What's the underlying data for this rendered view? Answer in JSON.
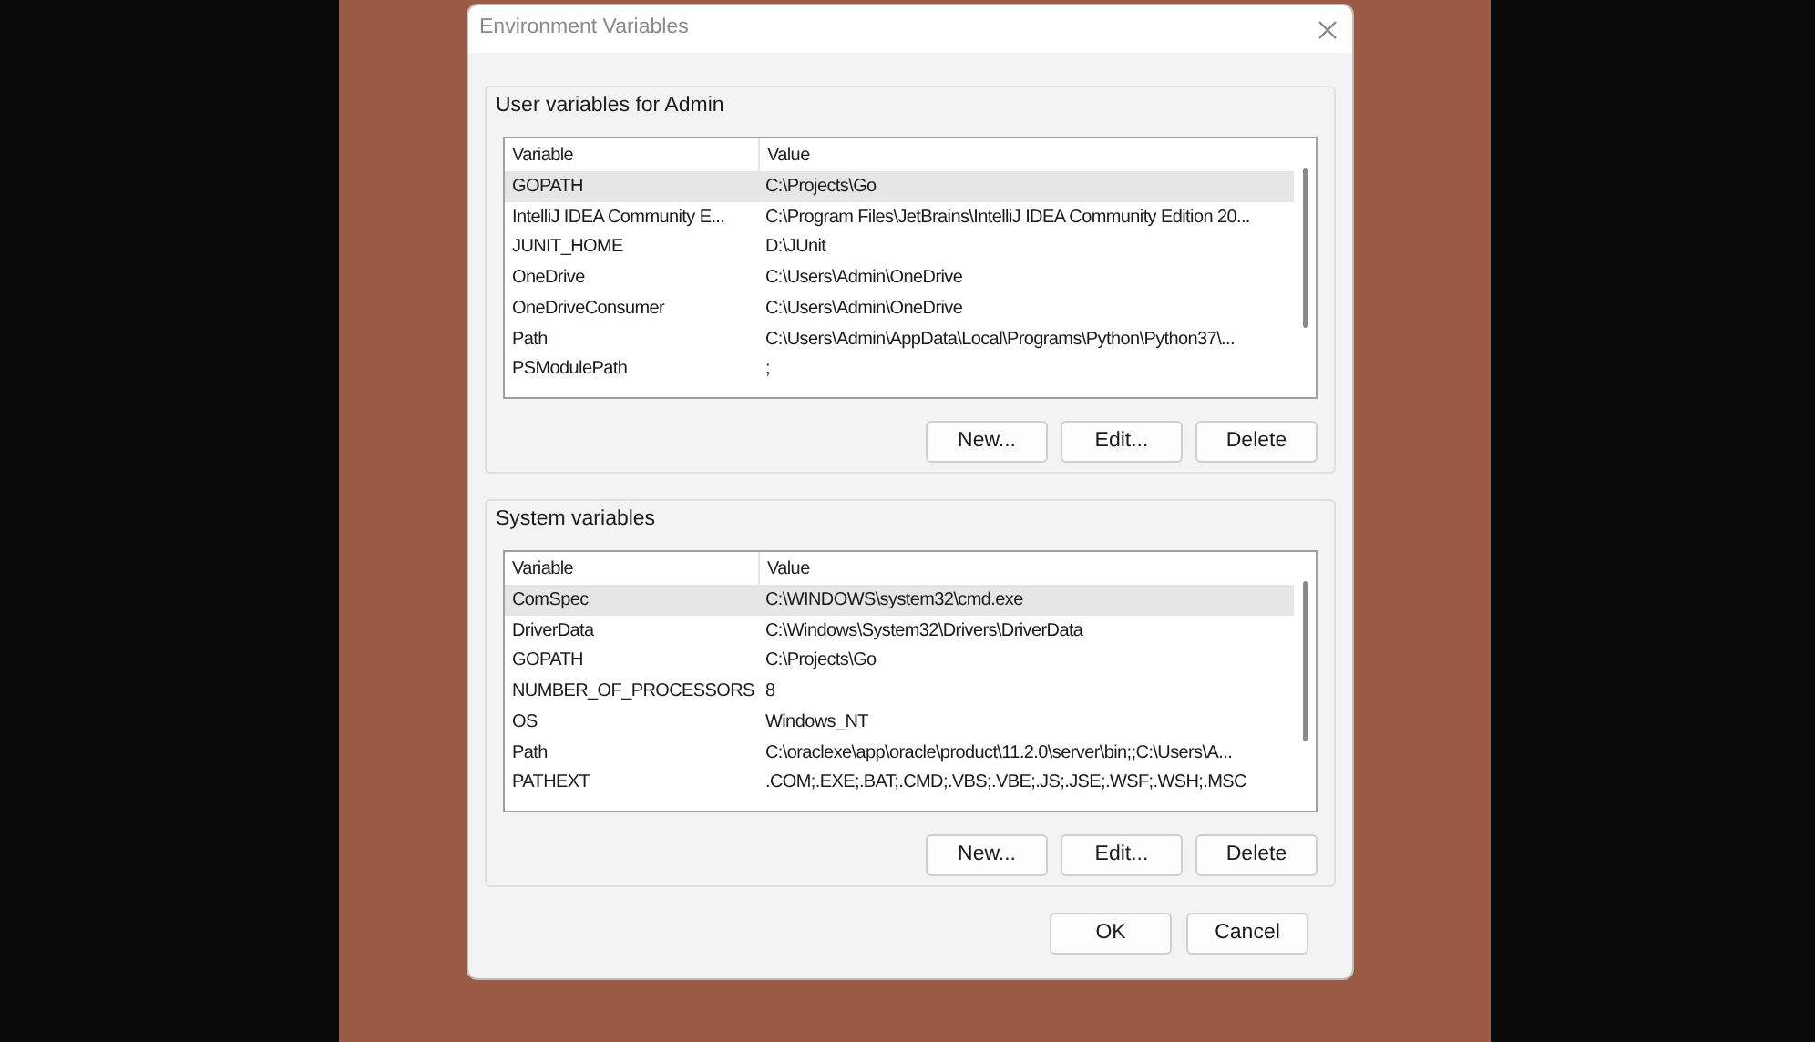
{
  "window": {
    "title": "Environment Variables"
  },
  "groups": [
    {
      "title": "User variables for Admin",
      "columns": [
        "Variable",
        "Value"
      ],
      "rows": [
        {
          "cells": [
            "GOPATH",
            "C:\\Projects\\Go"
          ],
          "selected": true
        },
        {
          "cells": [
            "IntelliJ IDEA Community E...",
            "C:\\Program Files\\JetBrains\\IntelliJ IDEA Community Edition 20..."
          ],
          "selected": false
        },
        {
          "cells": [
            "JUNIT_HOME",
            "D:\\JUnit"
          ],
          "selected": false
        },
        {
          "cells": [
            "OneDrive",
            "C:\\Users\\Admin\\OneDrive"
          ],
          "selected": false
        },
        {
          "cells": [
            "OneDriveConsumer",
            "C:\\Users\\Admin\\OneDrive"
          ],
          "selected": false
        },
        {
          "cells": [
            "Path",
            "C:\\Users\\Admin\\AppData\\Local\\Programs\\Python\\Python37\\..."
          ],
          "selected": false
        },
        {
          "cells": [
            "PSModulePath",
            ";"
          ],
          "selected": false
        }
      ],
      "buttons": [
        "New...",
        "Edit...",
        "Delete"
      ]
    },
    {
      "title": "System variables",
      "columns": [
        "Variable",
        "Value"
      ],
      "rows": [
        {
          "cells": [
            "ComSpec",
            "C:\\WINDOWS\\system32\\cmd.exe"
          ],
          "selected": true
        },
        {
          "cells": [
            "DriverData",
            "C:\\Windows\\System32\\Drivers\\DriverData"
          ],
          "selected": false
        },
        {
          "cells": [
            "GOPATH",
            "C:\\Projects\\Go"
          ],
          "selected": false
        },
        {
          "cells": [
            "NUMBER_OF_PROCESSORS",
            "8"
          ],
          "selected": false
        },
        {
          "cells": [
            "OS",
            "Windows_NT"
          ],
          "selected": false
        },
        {
          "cells": [
            "Path",
            "C:\\oraclexe\\app\\oracle\\product\\11.2.0\\server\\bin;;C:\\Users\\A..."
          ],
          "selected": false
        },
        {
          "cells": [
            "PATHEXT",
            ".COM;.EXE;.BAT;.CMD;.VBS;.VBE;.JS;.JSE;.WSF;.WSH;.MSC"
          ],
          "selected": false
        }
      ],
      "buttons": [
        "New...",
        "Edit...",
        "Delete"
      ]
    }
  ],
  "footer_buttons": [
    "OK",
    "Cancel"
  ]
}
